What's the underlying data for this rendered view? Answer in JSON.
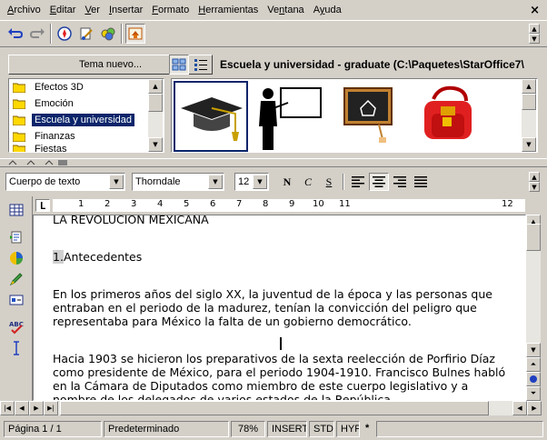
{
  "menu": {
    "items": [
      {
        "label": "Archivo",
        "mnemonic": "A",
        "rest": "rchivo"
      },
      {
        "label": "Editar",
        "mnemonic": "E",
        "rest": "ditar"
      },
      {
        "label": "Ver",
        "mnemonic": "V",
        "rest": "er"
      },
      {
        "label": "Insertar",
        "mnemonic": "I",
        "rest": "nsertar"
      },
      {
        "label": "Formato",
        "mnemonic": "F",
        "rest": "ormato"
      },
      {
        "label": "Herramientas",
        "mnemonic": "H",
        "rest": "erramientas"
      },
      {
        "label": "Ventana",
        "mnemonic": "n",
        "pre": "Ve",
        "rest": "tana"
      },
      {
        "label": "Ayuda",
        "mnemonic": "y",
        "pre": "A",
        "rest": "uda"
      }
    ],
    "close_glyph": "×"
  },
  "gallery": {
    "new_theme_button": "Tema nuevo...",
    "title": "Escuela y universidad - graduate (C:\\Paquetes\\StarOffice7\\",
    "themes": [
      {
        "label": "Efectos 3D",
        "selected": false
      },
      {
        "label": "Emoción",
        "selected": false
      },
      {
        "label": "Escuela y universidad",
        "selected": true
      },
      {
        "label": "Finanzas",
        "selected": false
      },
      {
        "label": "Fiestas",
        "selected": false
      }
    ],
    "thumbnails": [
      "graduate-cap-icon",
      "teacher-board-icon",
      "chalkboard-icon",
      "school-bag-icon"
    ]
  },
  "format": {
    "paragraph_style": "Cuerpo de texto",
    "font_name": "Thorndale",
    "font_size": "12",
    "bold": "N",
    "italic": "C",
    "underline": "S"
  },
  "ruler": {
    "corner": "L",
    "numbers": [
      "1",
      "2",
      "3",
      "4",
      "5",
      "6",
      "7",
      "8",
      "9",
      "10",
      "11",
      "12"
    ]
  },
  "document": {
    "title_line": "LA REVOLUCIÓN MEXICANA",
    "heading_num": "1.",
    "heading": "Antecedentes",
    "para1": "En los primeros años del siglo XX, la juventud de la época y las personas que entraban en el periodo de la madurez, tenían la convicción del peligro que representaba para México la falta de un gobierno democrático.",
    "para2": "Hacia 1903 se hicieron los preparativos de la sexta reelección de Porfirio Díaz como presidente de México, para el periodo 1904-1910. Francisco Bulnes habló en la Cámara de Diputados como miembro de este cuerpo legislativo y a nombre de los delegados de varios estados de la República"
  },
  "status": {
    "page": "Página  1 / 1",
    "page_style": "Predeterminado",
    "zoom": "78%",
    "insert_mode": "INSERT",
    "selection_mode": "STD",
    "hyperlink_mode": "HYP",
    "modified": "*"
  },
  "colors": {
    "chrome": "#d4d0c8",
    "selection": "#0a246a",
    "folder": "#ffd800"
  }
}
